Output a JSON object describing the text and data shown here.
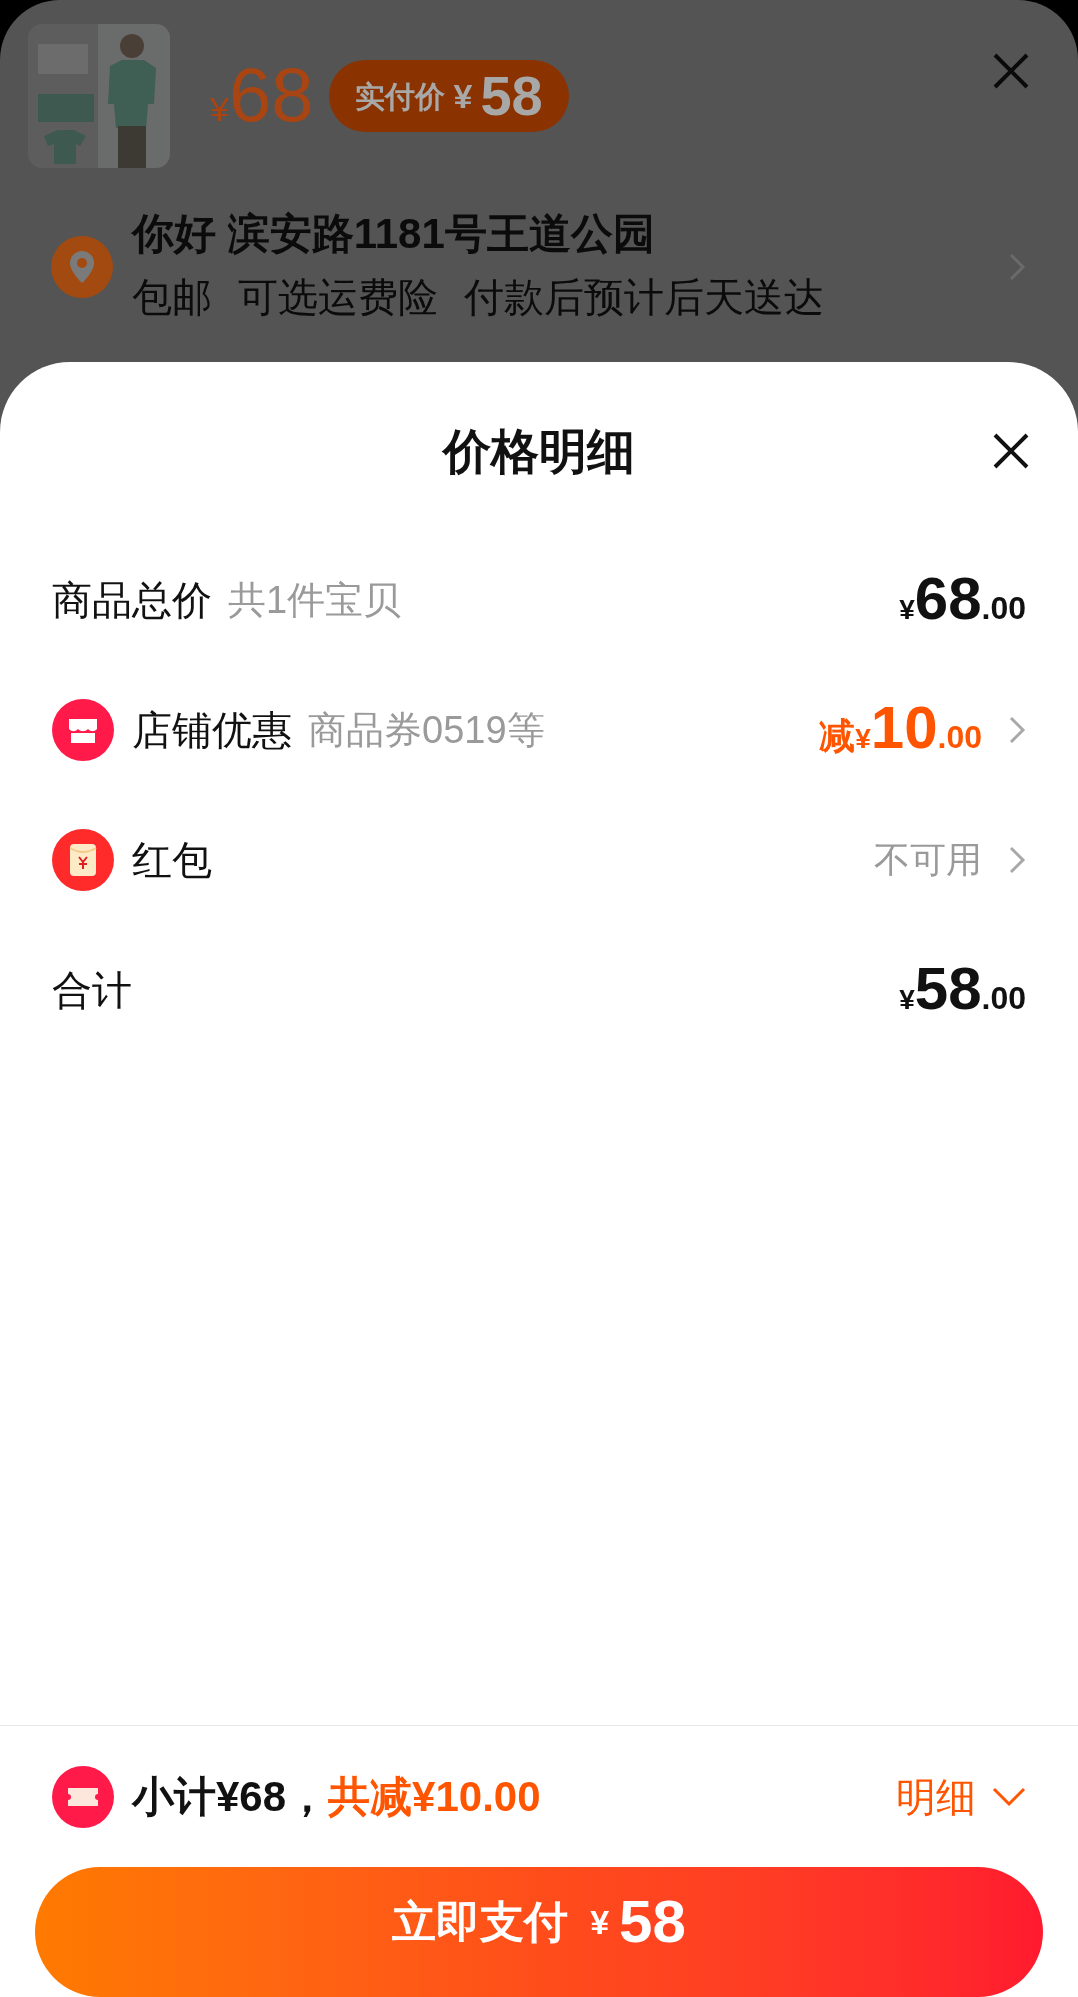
{
  "order_header": {
    "price_symbol": "¥",
    "price": "68",
    "pay_badge": {
      "label": "实付价",
      "symbol": "¥",
      "amount": "58"
    }
  },
  "address": {
    "title": "你好 滨安路1181号王道公园",
    "details": [
      "包邮",
      "可选运费险",
      "付款后预计后天送达"
    ]
  },
  "sheet": {
    "title": "价格明细",
    "rows": [
      {
        "kind": "amount",
        "label": "商品总价",
        "note": "共1件宝贝",
        "amount": {
          "symbol": "¥",
          "integer": "68",
          "decimal": ".00"
        }
      },
      {
        "kind": "discount",
        "label": "店铺优惠",
        "note": "商品券0519等",
        "amount": {
          "prefix": "减",
          "symbol": "¥",
          "integer": "10",
          "decimal": ".00"
        }
      },
      {
        "kind": "status",
        "label": "红包",
        "status": "不可用"
      },
      {
        "kind": "amount",
        "label": "合计",
        "amount": {
          "symbol": "¥",
          "integer": "58",
          "decimal": ".00"
        }
      }
    ]
  },
  "summary": {
    "subtotal": "小计¥68，",
    "discount": "共减¥10.00",
    "detail_toggle": {
      "label": "明细",
      "expanded": true
    }
  },
  "pay_button": {
    "label": "立即支付",
    "symbol": "¥",
    "amount": "58"
  }
}
